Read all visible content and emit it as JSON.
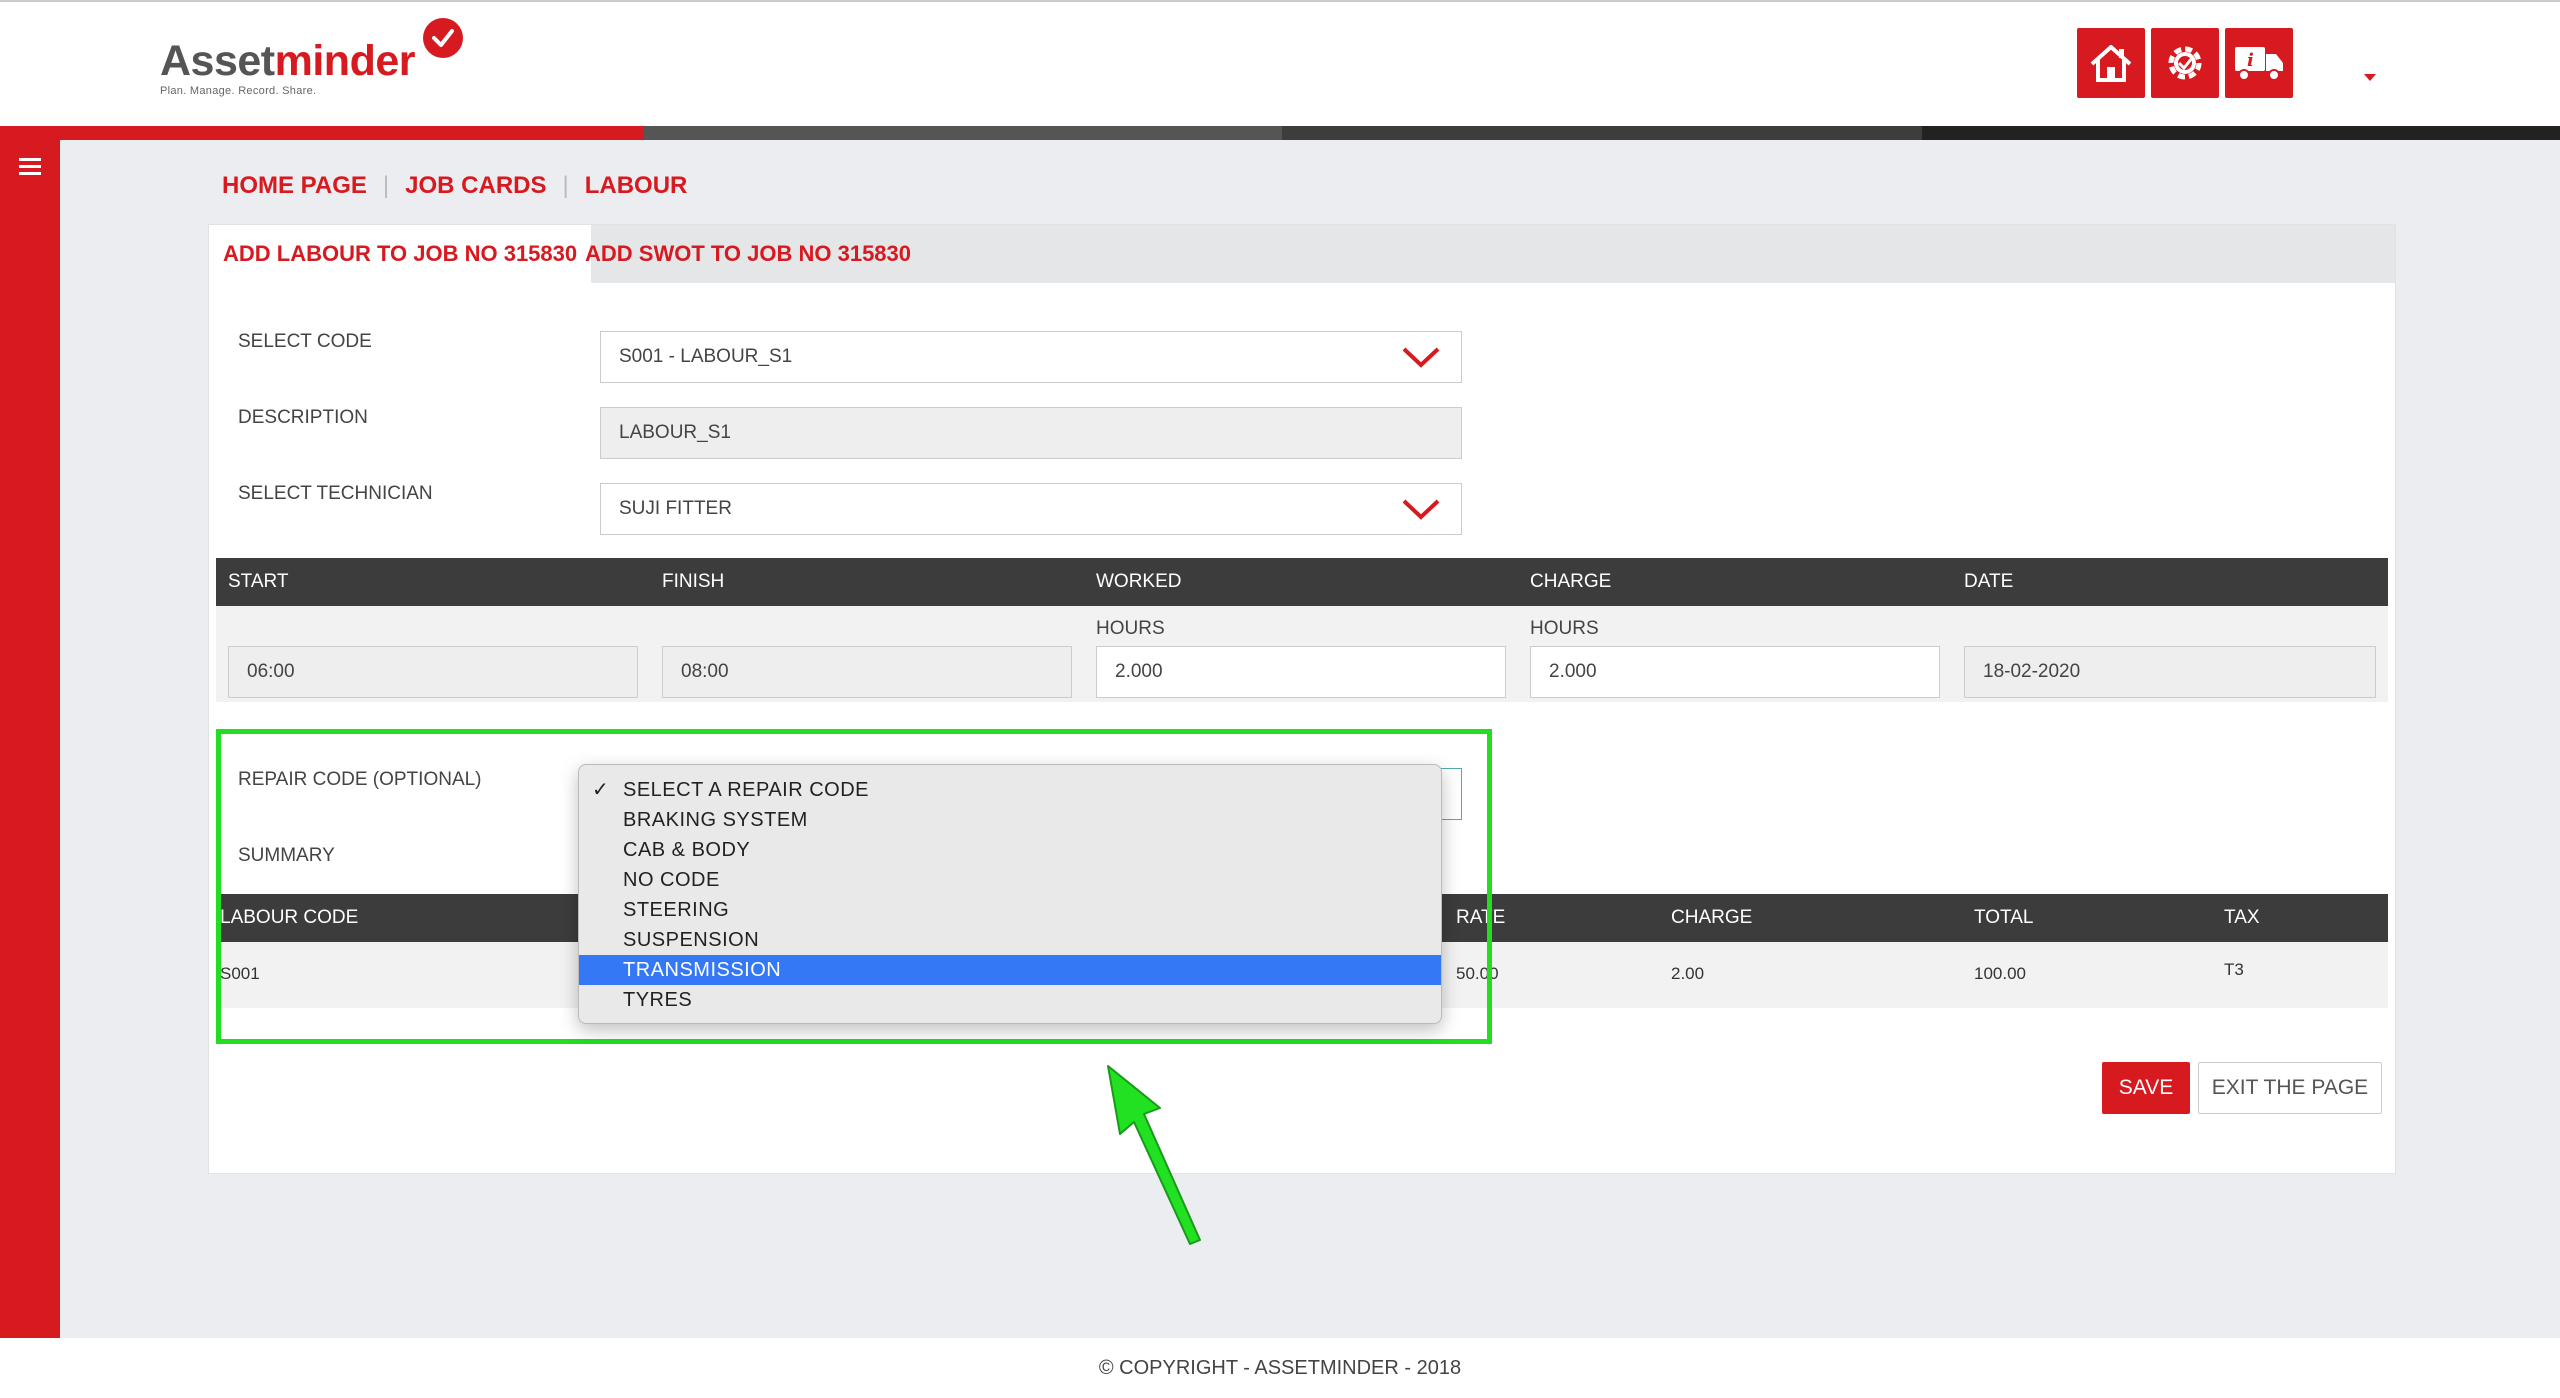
{
  "logo": {
    "text_a": "Asset",
    "text_b": "minder",
    "tagline": "Plan. Manage. Record. Share."
  },
  "header_icons": [
    "home-icon",
    "settings-icon",
    "truck-info-icon"
  ],
  "breadcrumb": [
    "HOME PAGE",
    "JOB CARDS",
    "LABOUR"
  ],
  "tabs": [
    "ADD LABOUR TO JOB NO 315830",
    "ADD SWOT TO JOB NO 315830"
  ],
  "form": {
    "select_code_label": "SELECT CODE",
    "select_code_value": "S001 - LABOUR_S1",
    "description_label": "DESCRIPTION",
    "description_value": "LABOUR_S1",
    "technician_label": "SELECT TECHNICIAN",
    "technician_value": "SUJI FITTER",
    "repair_label": "REPAIR CODE (OPTIONAL)",
    "summary_label": "SUMMARY"
  },
  "time_table": {
    "headers": [
      "START",
      "FINISH",
      "WORKED",
      "CHARGE",
      "DATE"
    ],
    "worked_sub": "HOURS",
    "charge_sub": "HOURS",
    "start": "06:00",
    "finish": "08:00",
    "worked": "2.000",
    "charge": "2.000",
    "date": "18-02-2020"
  },
  "labour_table": {
    "headers": [
      "LABOUR CODE",
      "RATE",
      "CHARGE",
      "TOTAL",
      "TAX"
    ],
    "row": {
      "code": "S001",
      "rate": "50.00",
      "charge": "2.00",
      "total": "100.00",
      "tax": "T3"
    }
  },
  "dropdown": {
    "options": [
      "SELECT A REPAIR CODE",
      "BRAKING SYSTEM",
      "CAB & BODY",
      "NO CODE",
      "STEERING",
      "SUSPENSION",
      "TRANSMISSION",
      "TYRES"
    ],
    "checked": "SELECT A REPAIR CODE",
    "highlighted": "TRANSMISSION"
  },
  "buttons": {
    "save": "SAVE",
    "exit": "EXIT THE PAGE"
  },
  "footer": "© COPYRIGHT - ASSETMINDER - 2018",
  "colors": {
    "brand_red": "#d71920",
    "highlight_green": "#22dd22",
    "selection_blue": "#3478f6"
  }
}
